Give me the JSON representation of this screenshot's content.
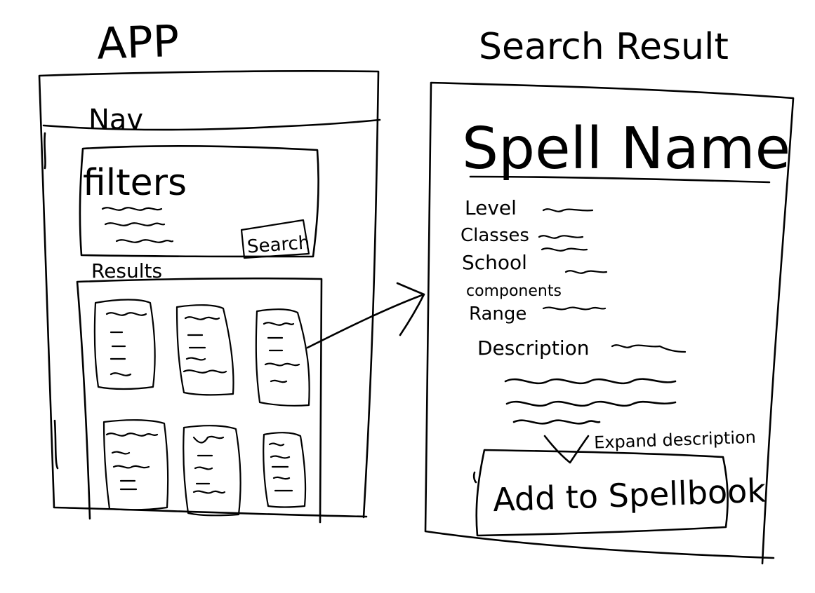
{
  "app": {
    "heading": "APP",
    "nav_label": "Nav",
    "filters": {
      "title": "filters",
      "search_button": "Search"
    },
    "results_label": "Results"
  },
  "search_result": {
    "heading": "Search Result",
    "spell_name": "Spell Name",
    "fields": [
      "Level",
      "Classes",
      "School",
      "components",
      "Range"
    ],
    "description_label": "Description",
    "expand_note": "Expand description",
    "add_button": "Add to Spellbook"
  }
}
